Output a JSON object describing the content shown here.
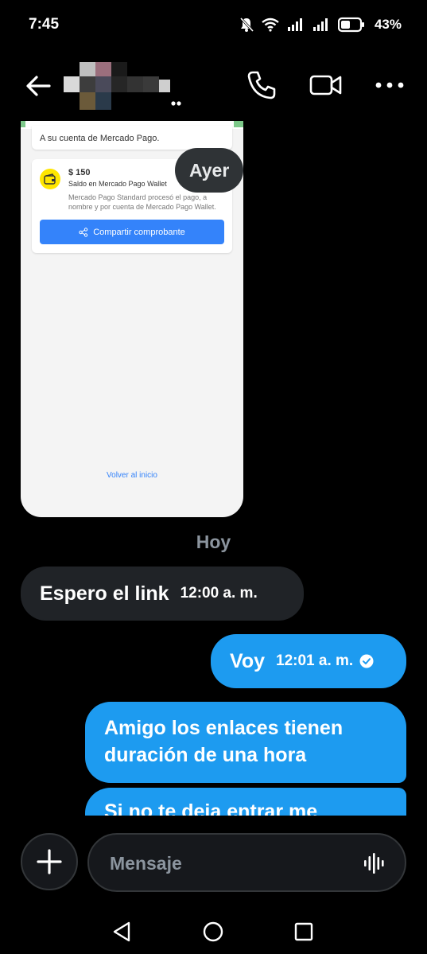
{
  "status_bar": {
    "time": "7:45",
    "battery": "43%"
  },
  "header": {
    "contact_name": "· · ·"
  },
  "image_message": {
    "card1_text": "A su cuenta de Mercado Pago.",
    "amount": "$ 150",
    "amount_sub": "Saldo en Mercado Pago Wallet",
    "description": "Mercado Pago Standard procesó el pago, a nombre y por cuenta de Mercado Pago Wallet.",
    "share_label": "Compartir comprobante",
    "back_link": "Volver al inicio"
  },
  "date_pill": "Ayer",
  "day_separator": "Hoy",
  "messages": [
    {
      "direction": "incoming",
      "text": "Espero el link",
      "time": "12:00 a. m."
    },
    {
      "direction": "outgoing",
      "text": "Voy",
      "time": "12:01 a. m.",
      "status": "read"
    },
    {
      "direction": "outgoing",
      "text": "Amigo los enlaces tienen duración de una hora"
    },
    {
      "direction": "outgoing",
      "text": "Si no te deja entrar me"
    }
  ],
  "composer": {
    "placeholder": "Mensaje"
  },
  "colors": {
    "outgoing": "#1d9bf0",
    "incoming": "#202327",
    "background": "#000000",
    "mp_blue": "#3483fa",
    "mp_yellow": "#ffe600"
  },
  "icons": [
    "back-arrow-icon",
    "phone-icon",
    "video-icon",
    "more-icon",
    "add-icon",
    "voice-wave-icon",
    "arrow-down-icon",
    "read-check-icon",
    "share-icon",
    "wallet-icon",
    "nav-back-icon",
    "nav-home-icon",
    "nav-recents-icon"
  ]
}
